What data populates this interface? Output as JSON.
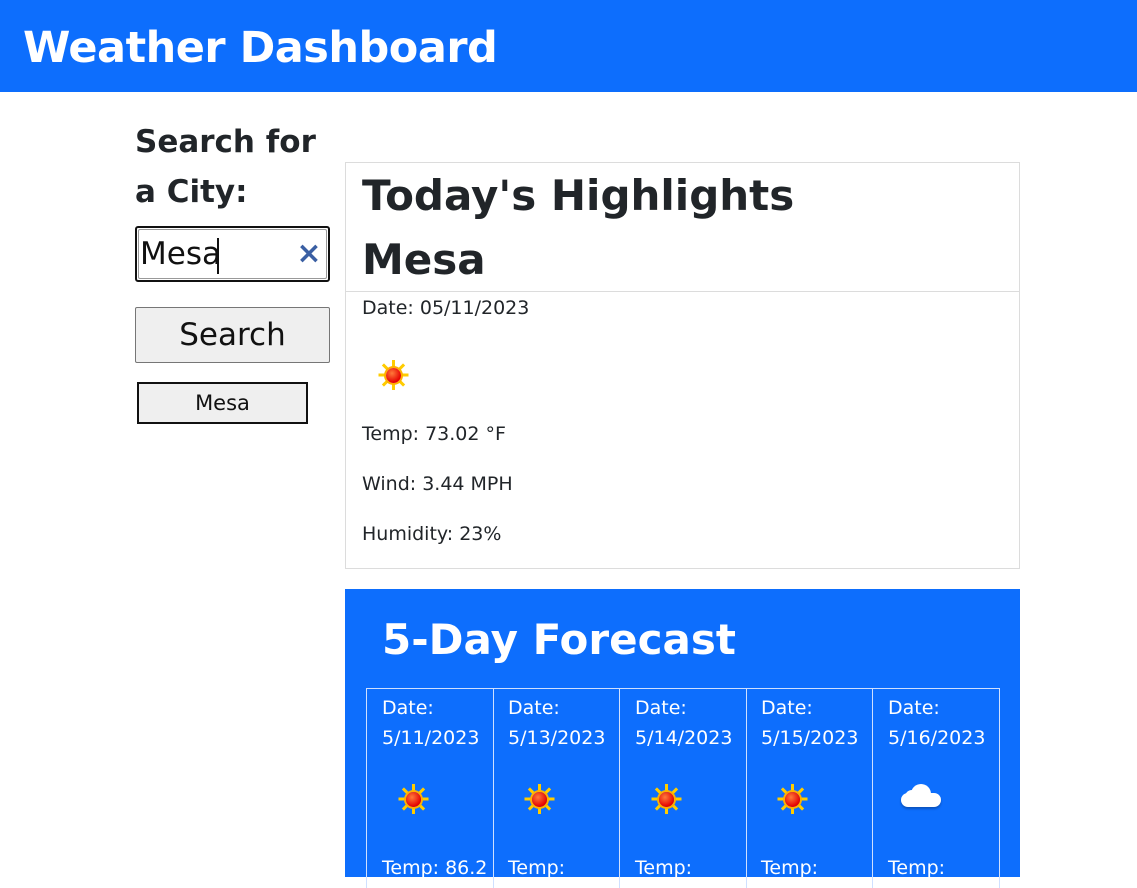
{
  "header": {
    "title": "Weather Dashboard"
  },
  "search": {
    "label": "Search for a City:",
    "value": "Mesa",
    "clear_symbol": "×",
    "button_label": "Search",
    "history": [
      "Mesa"
    ]
  },
  "today": {
    "title": "Today's Highlights",
    "city": "Mesa",
    "date": "Date: 05/11/2023",
    "icon": "sun-icon",
    "temp": "Temp: 73.02 °F",
    "wind": "Wind: 3.44 MPH",
    "humidity": "Humidity: 23%"
  },
  "forecast": {
    "title": "5-Day Forecast",
    "days": [
      {
        "label": "Date:",
        "date": "5/11/2023",
        "icon": "sun-icon",
        "temp": "Temp: 86.2"
      },
      {
        "label": "Date:",
        "date": "5/13/2023",
        "icon": "sun-icon",
        "temp": "Temp:"
      },
      {
        "label": "Date:",
        "date": "5/14/2023",
        "icon": "sun-icon",
        "temp": "Temp:"
      },
      {
        "label": "Date:",
        "date": "5/15/2023",
        "icon": "sun-icon",
        "temp": "Temp:"
      },
      {
        "label": "Date:",
        "date": "5/16/2023",
        "icon": "cloud-icon",
        "temp": "Temp:"
      }
    ]
  },
  "colors": {
    "primary": "#0d6efd",
    "text": "#212529"
  }
}
